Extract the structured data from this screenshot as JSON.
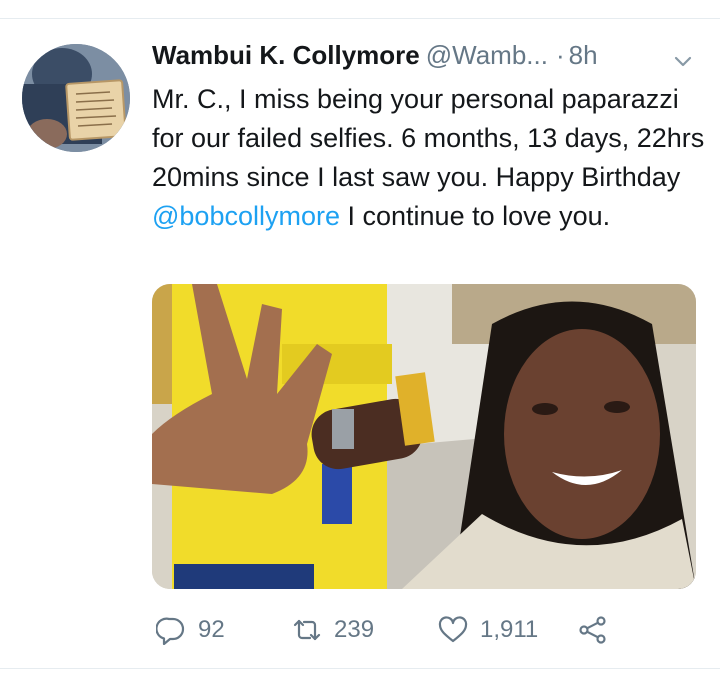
{
  "tweet": {
    "author_name": "Wambui K. Collymore",
    "author_handle": "@Wamb...",
    "separator": "·",
    "time_ago": "8h",
    "text_before_mention": "Mr. C., I miss being your personal paparazzi for our failed selfies. 6 months, 13 days, 22hrs 20mins since I last saw you. Happy Birthday ",
    "mention": "@bobcollymore",
    "text_after_mention": " I continue to love you."
  },
  "actions": {
    "reply": {
      "icon": "reply-icon",
      "count": "92"
    },
    "retweet": {
      "icon": "retweet-icon",
      "count": "239"
    },
    "like": {
      "icon": "heart-icon",
      "count": "1,911"
    },
    "share": {
      "icon": "share-icon"
    }
  },
  "colors": {
    "text": "#14171a",
    "secondary": "#657786",
    "link": "#1da1f2",
    "divider": "#e6ecf0"
  }
}
